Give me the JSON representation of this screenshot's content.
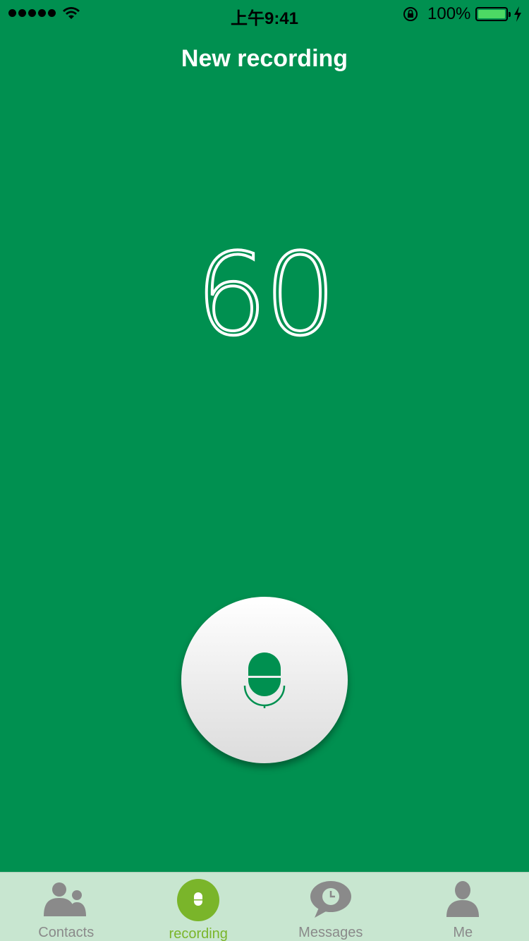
{
  "status_bar": {
    "time": "上午9:41",
    "battery_percent": "100%",
    "signal_bars": 5,
    "icons": [
      "signal-icon",
      "wifi-icon",
      "rotation-lock-icon",
      "battery-icon",
      "charging-icon"
    ]
  },
  "header": {
    "title": "New recording"
  },
  "main": {
    "countdown": "60"
  },
  "record_button": {
    "icon": "microphone-icon"
  },
  "tabs": [
    {
      "label": "Contacts",
      "icon": "contacts-icon",
      "active": false
    },
    {
      "label": "recording",
      "icon": "microphone-icon",
      "active": true
    },
    {
      "label": "Messages",
      "icon": "message-clock-icon",
      "active": false
    },
    {
      "label": "Me",
      "icon": "person-icon",
      "active": false
    }
  ],
  "colors": {
    "background": "#009050",
    "tab_bar": "#c8e6d0",
    "active_tab": "#7ab52a",
    "inactive_tab": "#8a8a8a",
    "mic": "#009050"
  }
}
